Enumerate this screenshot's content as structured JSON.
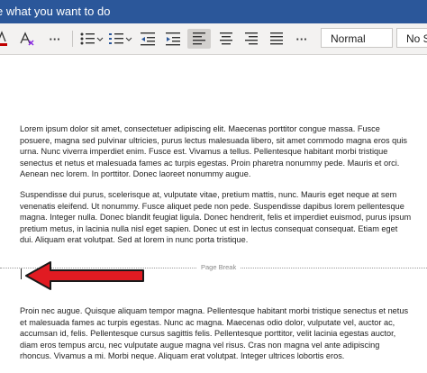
{
  "titlebar": {
    "search_text": "e what you want to do"
  },
  "ribbon": {
    "more_glyph": "···",
    "styles": {
      "normal": "Normal",
      "no_spacing": "No S"
    },
    "colors": {
      "font_color": "#c00000"
    }
  },
  "document": {
    "paragraphs": [
      "Lorem ipsum dolor sit amet, consectetuer adipiscing elit. Maecenas porttitor congue massa. Fusce posuere, magna sed pulvinar ultricies, purus lectus malesuada libero, sit amet commodo magna eros quis urna. Nunc viverra imperdiet enim. Fusce est. Vivamus a tellus. Pellentesque habitant morbi tristique senectus et netus et malesuada fames ac turpis egestas. Proin pharetra nonummy pede. Mauris et orci. Aenean nec lorem. In porttitor. Donec laoreet nonummy augue.",
      "Suspendisse dui purus, scelerisque at, vulputate vitae, pretium mattis, nunc. Mauris eget neque at sem venenatis eleifend. Ut nonummy. Fusce aliquet pede non pede. Suspendisse dapibus lorem pellentesque magna. Integer nulla. Donec blandit feugiat ligula. Donec hendrerit, felis et imperdiet euismod, purus ipsum pretium metus, in lacinia nulla nisl eget sapien. Donec ut est in lectus consequat consequat. Etiam eget dui. Aliquam erat volutpat. Sed at lorem in nunc porta tristique.",
      "Proin nec augue. Quisque aliquam tempor magna. Pellentesque habitant morbi tristique senectus et netus et malesuada fames ac turpis egestas. Nunc ac magna. Maecenas odio dolor, vulputate vel, auctor ac, accumsan id, felis. Pellentesque cursus sagittis felis. Pellentesque porttitor, velit lacinia egestas auctor, diam eros tempus arcu, nec vulputate augue magna vel risus. Cras non magna vel ante adipiscing rhoncus. Vivamus a mi. Morbi neque. Aliquam erat volutpat. Integer ultrices lobortis eros."
    ],
    "page_break_label": "Page Break",
    "annotation_arrow_color": "#e11b22"
  }
}
